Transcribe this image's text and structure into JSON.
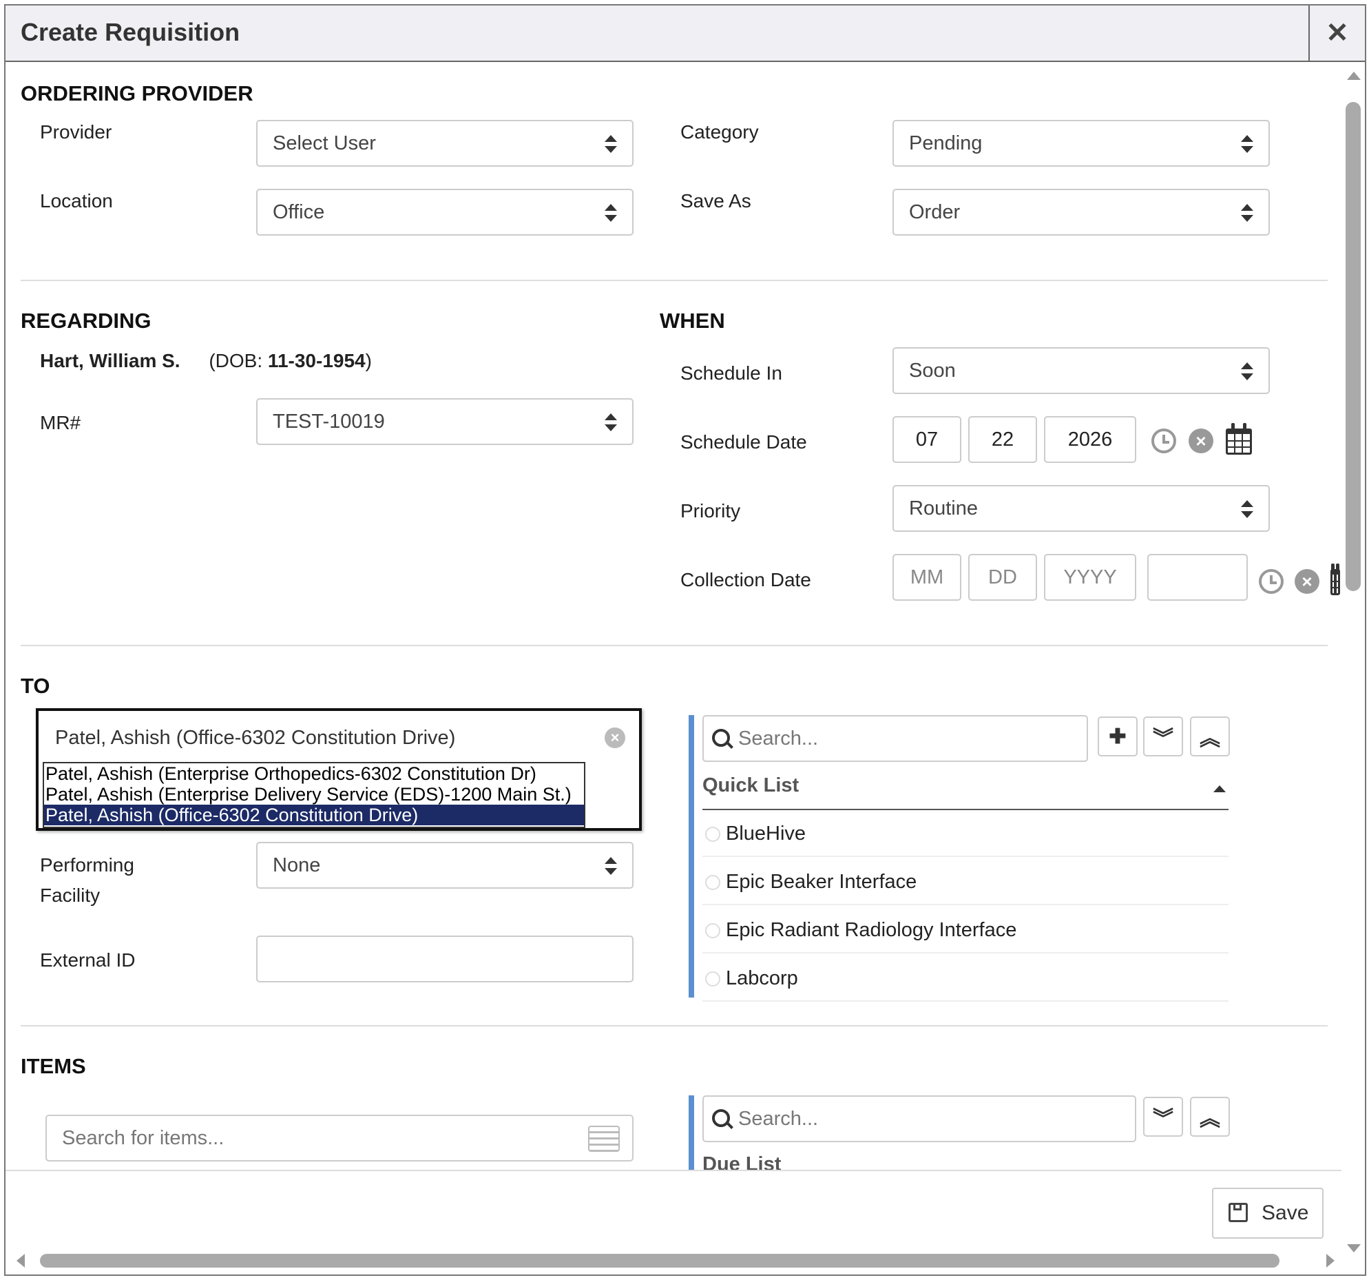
{
  "dialog": {
    "title": "Create Requisition"
  },
  "ordering_provider": {
    "heading": "ORDERING PROVIDER",
    "provider_label": "Provider",
    "provider_value": "Select User",
    "location_label": "Location",
    "location_value": "Office",
    "category_label": "Category",
    "category_value": "Pending",
    "save_as_label": "Save As",
    "save_as_value": "Order"
  },
  "regarding": {
    "heading": "REGARDING",
    "patient_name": "Hart, William S.",
    "dob_prefix": "(DOB: ",
    "dob": "11-30-1954",
    "dob_suffix": ")",
    "mr_label": "MR#",
    "mr_value": "TEST-10019"
  },
  "when": {
    "heading": "WHEN",
    "schedule_in_label": "Schedule In",
    "schedule_in_value": "Soon",
    "schedule_date_label": "Schedule Date",
    "schedule_date": {
      "mm": "07",
      "dd": "22",
      "yyyy": "2026"
    },
    "priority_label": "Priority",
    "priority_value": "Routine",
    "collection_date_label": "Collection Date",
    "collection_date_placeholders": {
      "mm": "MM",
      "dd": "DD",
      "yyyy": "YYYY"
    }
  },
  "to": {
    "heading": "TO",
    "input_value": "Patel, Ashish (Office-6302 Constitution Drive)",
    "options": [
      "Patel, Ashish (Enterprise Orthopedics-6302 Constitution Dr)",
      "Patel, Ashish (Enterprise Delivery Service (EDS)-1200 Main St.)",
      "Patel, Ashish (Office-6302 Constitution Drive)"
    ],
    "selected_index": 2,
    "performing_facility_label_1": "Performing",
    "performing_facility_label_2": "Facility",
    "performing_facility_value": "None",
    "external_id_label": "External ID",
    "external_id_value": "",
    "search_placeholder": "Search...",
    "quick_list_title": "Quick List",
    "quick_list": [
      "BlueHive",
      "Epic Beaker Interface",
      "Epic Radiant Radiology Interface",
      "Labcorp"
    ]
  },
  "items": {
    "heading": "ITEMS",
    "search_placeholder": "Search for items...",
    "right_search_placeholder": "Search...",
    "due_list_title": "Due List"
  },
  "footer": {
    "save_label": "Save"
  },
  "colors": {
    "accent_bar": "#5b8fd0",
    "selected_option": "#1c2a66"
  }
}
